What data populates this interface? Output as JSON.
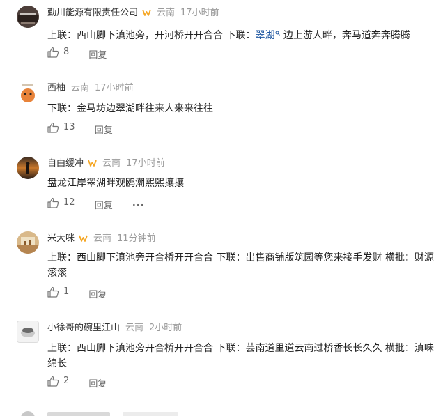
{
  "comments": [
    {
      "username": "勤川能源有限责任公司",
      "verified": true,
      "location": "云南",
      "time": "17小时前",
      "text_pre": "上联：西山脚下滇池旁，开河桥开开合合 下联：",
      "text_link": "翠湖",
      "text_post": " 边上游人畔，奔马道奔奔腾腾",
      "likes": "8",
      "reply_label": "回复"
    },
    {
      "username": "西柚",
      "verified": false,
      "location": "云南",
      "time": "17小时前",
      "text": "下联：金马坊边翠湖畔往来人来来往往",
      "likes": "13",
      "reply_label": "回复"
    },
    {
      "username": "自由缓冲",
      "verified": true,
      "location": "云南",
      "time": "17小时前",
      "text": "盘龙江岸翠湖畔观鸥潮熙熙攘攘",
      "likes": "12",
      "reply_label": "回复",
      "more_label": "···"
    },
    {
      "username": "米大咪",
      "verified": true,
      "location": "云南",
      "time": "11分钟前",
      "text": "上联：西山脚下滇池旁开合桥开开合合 下联：出售商铺版筑园等您来接手发财 横批：财源滚滚",
      "likes": "1",
      "reply_label": "回复"
    },
    {
      "username": "小徐哥的碗里江山",
      "verified": false,
      "location": "云南",
      "time": "2小时前",
      "text": "上联：西山脚下滇池旁开合桥开开合合 下联：芸南道里道云南过桥香长长久久 横批：滇味绵长",
      "likes": "2",
      "reply_label": "回复"
    }
  ],
  "colors": {
    "link": "#1e56a0",
    "meta": "#9a9a9a",
    "badge": "#f5a623"
  },
  "icons": [
    "thumbs-up-icon",
    "verified-badge-icon",
    "search-icon",
    "more-icon"
  ]
}
